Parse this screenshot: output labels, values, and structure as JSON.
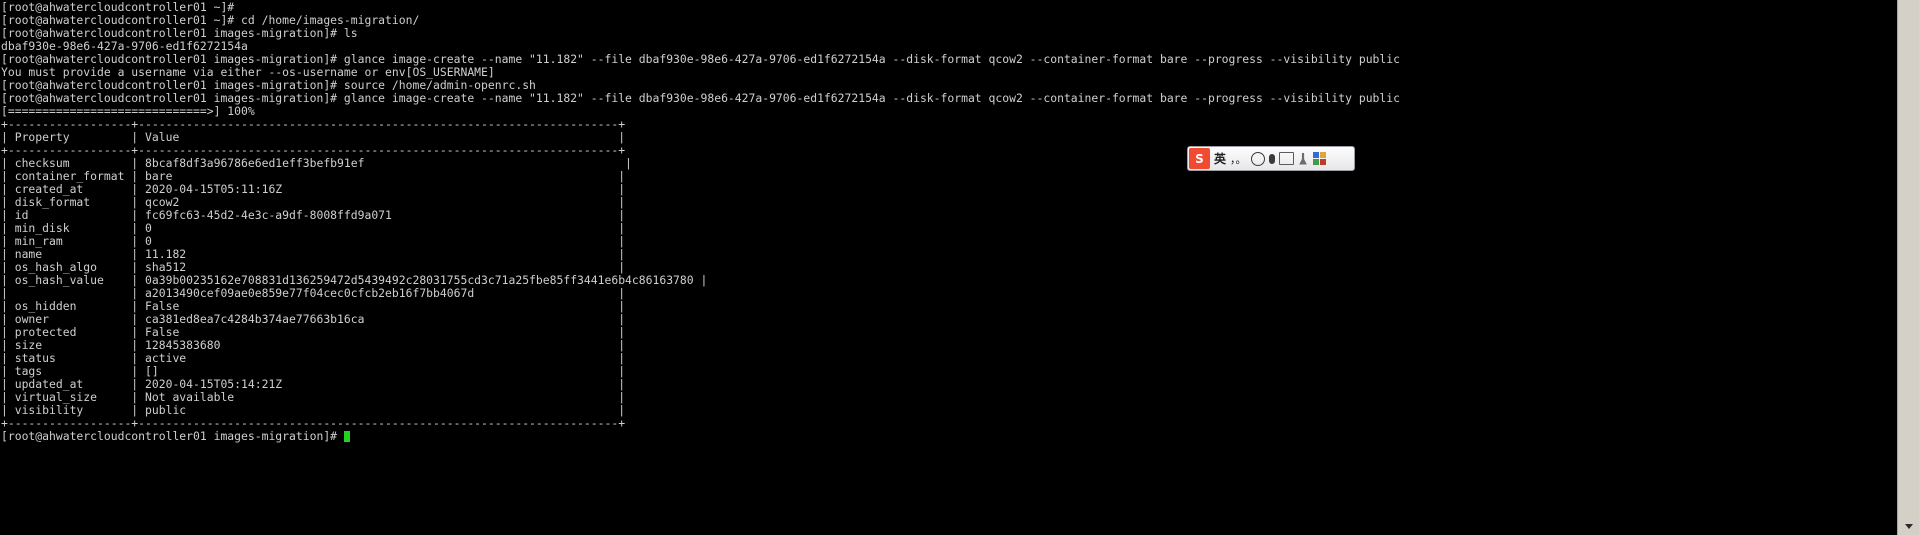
{
  "terminal": {
    "prompt_user_host_home": "[root@ahwatercloudcontroller01 ~]#",
    "prompt_user_host_dir": "[root@ahwatercloudcontroller01 images-migration]#",
    "cursor_color": "#22d21f",
    "foreground": "#cfcfcf",
    "background": "#000000",
    "lines": [
      "[root@ahwatercloudcontroller01 ~]#",
      "[root@ahwatercloudcontroller01 ~]# cd /home/images-migration/",
      "[root@ahwatercloudcontroller01 images-migration]# ls",
      "dbaf930e-98e6-427a-9706-ed1f6272154a",
      "[root@ahwatercloudcontroller01 images-migration]# glance image-create --name \"11.182\" --file dbaf930e-98e6-427a-9706-ed1f6272154a --disk-format qcow2 --container-format bare --progress --visibility public",
      "You must provide a username via either --os-username or env[OS_USERNAME]",
      "[root@ahwatercloudcontroller01 images-migration]# source /home/admin-openrc.sh",
      "[root@ahwatercloudcontroller01 images-migration]# glance image-create --name \"11.182\" --file dbaf930e-98e6-427a-9706-ed1f6272154a --disk-format qcow2 --container-format bare --progress --visibility public",
      "[=============================>] 100%",
      "+------------------+----------------------------------------------------------------------+",
      "| Property         | Value                                                                |",
      "+------------------+----------------------------------------------------------------------+",
      "| checksum         | 8bcaf8df3a96786e6ed1eff3befb91ef                                      |",
      "| container_format | bare                                                                 |",
      "| created_at       | 2020-04-15T05:11:16Z                                                 |",
      "| disk_format      | qcow2                                                                |",
      "| id               | fc69fc63-45d2-4e3c-a9df-8008ffd9a071                                 |",
      "| min_disk         | 0                                                                    |",
      "| min_ram          | 0                                                                    |",
      "| name             | 11.182                                                               |",
      "| os_hash_algo     | sha512                                                               |",
      "| os_hash_value    | 0a39b00235162e708831d136259472d5439492c28031755cd3c71a25fbe85ff3441e6b4c86163780 |",
      "|                  | a2013490cef09ae0e859e77f04cec0cfcb2eb16f7bb4067d                     |",
      "| os_hidden        | False                                                                |",
      "| owner            | ca381ed8ea7c4284b374ae77663b16ca                                     |",
      "| protected        | False                                                                |",
      "| size             | 12845383680                                                          |",
      "| status           | active                                                               |",
      "| tags             | []                                                                   |",
      "| updated_at       | 2020-04-15T05:14:21Z                                                 |",
      "| virtual_size     | Not available                                                        |",
      "| visibility       | public                                                               |",
      "+------------------+----------------------------------------------------------------------+",
      "[root@ahwatercloudcontroller01 images-migration]# "
    ],
    "progress": {
      "bar": "[=============================>] 100%",
      "percent": "100%"
    },
    "table": {
      "headers": [
        "Property",
        "Value"
      ],
      "rows": [
        [
          "checksum",
          "8bcaf8df3a96786e6ed1eff3befb91ef"
        ],
        [
          "container_format",
          "bare"
        ],
        [
          "created_at",
          "2020-04-15T05:11:16Z"
        ],
        [
          "disk_format",
          "qcow2"
        ],
        [
          "id",
          "fc69fc63-45d2-4e3c-a9df-8008ffd9a071"
        ],
        [
          "min_disk",
          "0"
        ],
        [
          "min_ram",
          "0"
        ],
        [
          "name",
          "11.182"
        ],
        [
          "os_hash_algo",
          "sha512"
        ],
        [
          "os_hash_value",
          "0a39b00235162e708831d136259472d5439492c28031755cd3c71a25fbe85ff3441e6b4c86163780a2013490cef09ae0e859e77f04cec0cfcb2eb16f7bb4067d"
        ],
        [
          "os_hidden",
          "False"
        ],
        [
          "owner",
          "ca381ed8ea7c4284b374ae77663b16ca"
        ],
        [
          "protected",
          "False"
        ],
        [
          "size",
          "12845383680"
        ],
        [
          "status",
          "active"
        ],
        [
          "tags",
          "[]"
        ],
        [
          "updated_at",
          "2020-04-15T05:14:21Z"
        ],
        [
          "virtual_size",
          "Not available"
        ],
        [
          "visibility",
          "public"
        ]
      ]
    }
  },
  "ime_toolbar": {
    "logo_label": "S",
    "logo_color": "#f04a32",
    "items": [
      {
        "name": "language-mode",
        "label": "英"
      },
      {
        "name": "punctuation-mode",
        "label": "，。"
      },
      {
        "name": "emoji",
        "label": "☺"
      },
      {
        "name": "voice-input",
        "label": "🎤"
      },
      {
        "name": "handwriting",
        "label": "▤"
      },
      {
        "name": "toolbox",
        "label": "⚒"
      },
      {
        "name": "settings-menu",
        "label": "▦"
      }
    ]
  },
  "scrollbar": {
    "down_arrow": "▼"
  }
}
